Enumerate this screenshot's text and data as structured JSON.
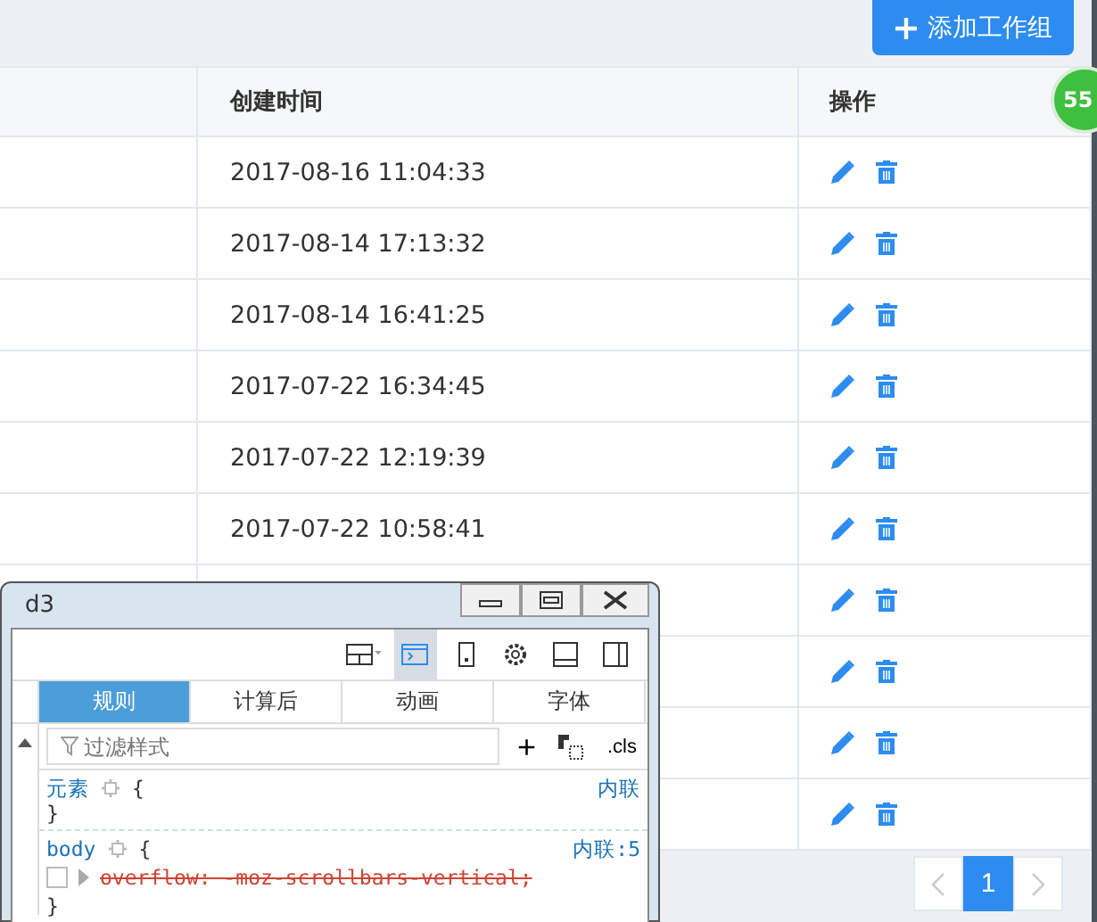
{
  "add_button": {
    "label": "添加工作组"
  },
  "table": {
    "columns": [
      "创建时间",
      "操作"
    ],
    "rows": [
      {
        "created": "2017-08-16 11:04:33"
      },
      {
        "created": "2017-08-14 17:13:32"
      },
      {
        "created": "2017-08-14 16:41:25"
      },
      {
        "created": "2017-07-22 16:34:45"
      },
      {
        "created": "2017-07-22 12:19:39"
      },
      {
        "created": "2017-07-22 10:58:41"
      },
      {},
      {},
      {},
      {}
    ]
  },
  "pagination": {
    "prev_disabled": true,
    "pages": [
      {
        "label": "1",
        "selected": true
      }
    ],
    "next_disabled": true
  },
  "badge": "55",
  "devtools": {
    "title": "d3",
    "toolbar_icons": [
      {
        "kind": "layout",
        "selected": false
      },
      {
        "kind": "console",
        "selected": true
      },
      {
        "kind": "phone",
        "selected": false
      },
      {
        "kind": "settings",
        "selected": false
      },
      {
        "kind": "dock-bottom",
        "selected": false
      },
      {
        "kind": "dock-side",
        "selected": false
      }
    ],
    "tabs": [
      {
        "label": "规则",
        "selected": true
      },
      {
        "label": "计算后",
        "selected": false
      },
      {
        "label": "动画",
        "selected": false
      },
      {
        "label": "字体",
        "selected": false
      }
    ],
    "filter": {
      "placeholder": "过滤样式"
    },
    "add_rule": "+",
    "cls": ".cls",
    "rules": [
      {
        "selector": "元素",
        "open": "{",
        "close": "}",
        "source": "内联"
      },
      {
        "selector": "body",
        "open": "{",
        "close": "}",
        "source": "内联:5",
        "declarations": [
          {
            "text": "overflow: -moz-scrollbars-vertical;",
            "checked": false,
            "overridden": true
          }
        ]
      }
    ]
  }
}
